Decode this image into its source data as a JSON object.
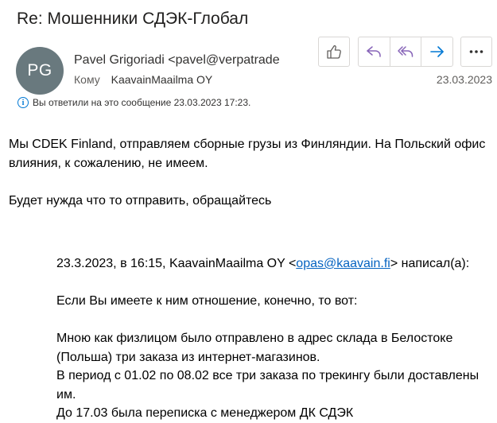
{
  "message": {
    "subject": "Re: Мошенники СДЭК-Глобал",
    "avatar_initials": "PG",
    "from": "Pavel Grigoriadi <pavel@verpatrade",
    "to_label": "Кому",
    "to_name": "KaavainMaailma OY",
    "date": "23.03.2023",
    "info": "Вы ответили на это сообщение 23.03.2023 17:23."
  },
  "toolbar": {
    "like_icon": "thumbs-up-icon",
    "reply_icon": "reply-icon",
    "reply_all_icon": "reply-all-icon",
    "forward_icon": "forward-icon",
    "more_icon": "more-icon"
  },
  "body": {
    "line1": "Мы CDEK Finland, отправляем сборные грузы из Финляндии. На Польский офис влияния, к сожалению, не имеем.",
    "line2": "Будет нужда что то отправить, обращайтесь"
  },
  "quote": {
    "header_before": "23.3.2023, в 16:15, KaavainMaailma OY <",
    "header_email": "opas@kaavain.fi",
    "header_after": "> написал(а):",
    "p1": "Если Вы имеете к ним отношение, конечно, то вот:",
    "p2": "Мною как физлицом было отправлено в адрес склада в Белостоке (Польша) три заказа из интернет-магазинов.",
    "p3": "В период с 01.02 по 08.02 все три заказа по трекингу были доставлены им.",
    "p4": "До 17.03 была переписка с менеджером ДК СДЭК"
  },
  "colors": {
    "accent": "#0078d4",
    "reply_purple": "#8764b8",
    "avatar_bg": "#69797e"
  }
}
